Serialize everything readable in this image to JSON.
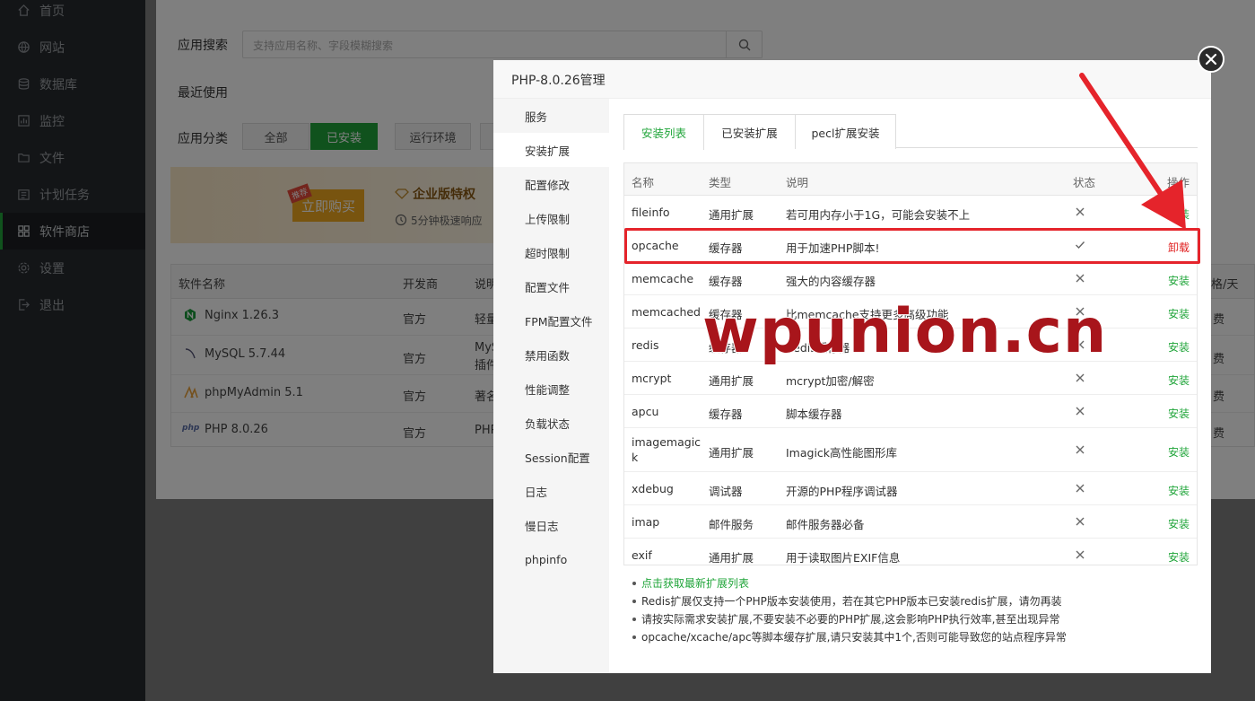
{
  "sidebar": {
    "items": [
      {
        "label": "首页",
        "icon": "home-icon"
      },
      {
        "label": "网站",
        "icon": "globe-icon"
      },
      {
        "label": "数据库",
        "icon": "database-icon"
      },
      {
        "label": "监控",
        "icon": "monitor-icon"
      },
      {
        "label": "文件",
        "icon": "folder-icon"
      },
      {
        "label": "计划任务",
        "icon": "calendar-icon"
      },
      {
        "label": "软件商店",
        "icon": "grid-icon",
        "active": true
      },
      {
        "label": "设置",
        "icon": "gear-icon"
      },
      {
        "label": "退出",
        "icon": "logout-icon"
      }
    ]
  },
  "background": {
    "search_label": "应用搜索",
    "search_placeholder": "支持应用名称、字段模糊搜索",
    "recent_label": "最近使用",
    "category_label": "应用分类",
    "categories": [
      "全部",
      "已安装",
      "运行环境"
    ],
    "banner": {
      "buy_label": "立即购买",
      "hot_tag": "推荐",
      "title": "企业版特权",
      "subtitle": "5分钟极速响应"
    },
    "table": {
      "headers": [
        "软件名称",
        "开发商",
        "说明"
      ],
      "right_header": "格/天",
      "rows": [
        {
          "name": "Nginx 1.26.3",
          "dev": "官方",
          "desc": "轻量",
          "price": "费"
        },
        {
          "name": "MySQL 5.7.44",
          "dev": "官方",
          "desc": "MyS",
          "desc2": "插件",
          "price": "费"
        },
        {
          "name": "phpMyAdmin 5.1",
          "dev": "官方",
          "desc": "著名",
          "price": "费"
        },
        {
          "name": "PHP 8.0.26",
          "dev": "官方",
          "desc": "PHP",
          "price": "费"
        }
      ]
    }
  },
  "modal": {
    "title": "PHP-8.0.26管理",
    "nav": [
      "服务",
      "安装扩展",
      "配置修改",
      "上传限制",
      "超时限制",
      "配置文件",
      "FPM配置文件",
      "禁用函数",
      "性能调整",
      "负载状态",
      "Session配置",
      "日志",
      "慢日志",
      "phpinfo"
    ],
    "active_nav": 1,
    "tabs": [
      "安装列表",
      "已安装扩展",
      "pecl扩展安装"
    ],
    "table": {
      "headers": {
        "name": "名称",
        "type": "类型",
        "desc": "说明",
        "status": "状态",
        "action": "操作"
      },
      "rows": [
        {
          "name": "fileinfo",
          "type": "通用扩展",
          "desc": "若可用内存小于1G，可能会安装不上",
          "installed": false,
          "action": "安装"
        },
        {
          "name": "opcache",
          "type": "缓存器",
          "desc": "用于加速PHP脚本!",
          "installed": true,
          "action": "卸载"
        },
        {
          "name": "memcache",
          "type": "缓存器",
          "desc": "强大的内容缓存器",
          "installed": false,
          "action": "安装"
        },
        {
          "name": "memcached",
          "type": "缓存器",
          "desc": "比memcache支持更多高级功能",
          "installed": false,
          "action": "安装"
        },
        {
          "name": "redis",
          "type": "缓存器",
          "desc": "Redis缓存器",
          "installed": false,
          "action": "安装"
        },
        {
          "name": "mcrypt",
          "type": "通用扩展",
          "desc": "mcrypt加密/解密",
          "installed": false,
          "action": "安装"
        },
        {
          "name": "apcu",
          "type": "缓存器",
          "desc": "脚本缓存器",
          "installed": false,
          "action": "安装"
        },
        {
          "name": "imagemagic",
          "name2": "k",
          "type": "通用扩展",
          "desc": "Imagick高性能图形库",
          "installed": false,
          "action": "安装"
        },
        {
          "name": "xdebug",
          "type": "调试器",
          "desc": "开源的PHP程序调试器",
          "installed": false,
          "action": "安装"
        },
        {
          "name": "imap",
          "type": "邮件服务",
          "desc": "邮件服务器必备",
          "installed": false,
          "action": "安装"
        },
        {
          "name": "exif",
          "type": "通用扩展",
          "desc": "用于读取图片EXIF信息",
          "installed": false,
          "action": "安装"
        }
      ]
    },
    "notes": [
      "点击获取最新扩展列表",
      "Redis扩展仅支持一个PHP版本安装使用，若在其它PHP版本已安装redis扩展，请勿再装",
      "请按实际需求安装扩展,不要安装不必要的PHP扩展,这会影响PHP执行效率,甚至出现异常",
      "opcache/xcache/apc等脚本缓存扩展,请只安装其中1个,否则可能导致您的站点程序异常"
    ]
  },
  "watermark": "wpunion.cn",
  "colors": {
    "accent": "#20a53a",
    "danger": "#e02020",
    "highlight": "#e5242b",
    "sidebar_bg": "#262a2f"
  }
}
